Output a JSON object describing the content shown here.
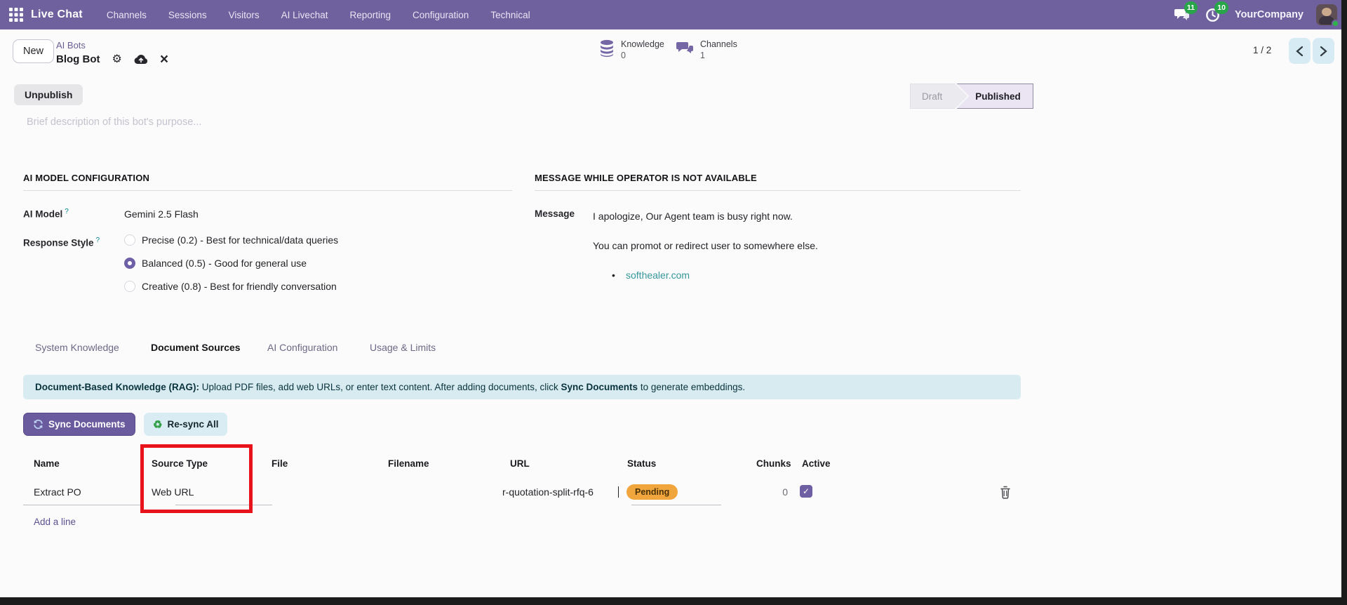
{
  "nav": {
    "app_name": "Live Chat",
    "menus": [
      "Channels",
      "Sessions",
      "Visitors",
      "AI Livechat",
      "Reporting",
      "Configuration",
      "Technical"
    ],
    "messages_badge": "11",
    "activities_badge": "10",
    "company": "YourCompany"
  },
  "control_panel": {
    "new_button": "New",
    "breadcrumb_parent": "AI Bots",
    "breadcrumb_current": "Blog Bot",
    "pager": "1 / 2",
    "stat_buttons": [
      {
        "label": "Knowledge",
        "value": "0",
        "icon": "database-icon"
      },
      {
        "label": "Channels",
        "value": "1",
        "icon": "chat-bubbles-icon"
      }
    ]
  },
  "form": {
    "unpublish_button": "Unpublish",
    "stages": {
      "draft": "Draft",
      "published": "Published",
      "active_stage": "Published"
    },
    "description_placeholder": "Brief description of this bot's purpose...",
    "ai_section": {
      "title": "AI MODEL CONFIGURATION",
      "ai_model_label": "AI Model",
      "help_marker": "?",
      "ai_model_value": "Gemini 2.5 Flash",
      "response_style_label": "Response Style",
      "options": [
        {
          "label": "Precise (0.2) - Best for technical/data queries",
          "selected": false
        },
        {
          "label": "Balanced (0.5) - Good for general use",
          "selected": true
        },
        {
          "label": "Creative (0.8) - Best for friendly conversation",
          "selected": false
        }
      ]
    },
    "message_section": {
      "title": "MESSAGE WHILE OPERATOR IS NOT AVAILABLE",
      "label": "Message",
      "line1": "I apologize, Our Agent team is busy right now.",
      "line2": "You can promot or redirect user to somewhere else.",
      "bullet": "•",
      "bullet_link": "softhealer.com"
    }
  },
  "tabs": [
    {
      "label": "System Knowledge",
      "active": false
    },
    {
      "label": "Document Sources",
      "active": true
    },
    {
      "label": "AI Configuration",
      "active": false
    },
    {
      "label": "Usage & Limits",
      "active": false
    }
  ],
  "rag_banner": {
    "bold_intro": "Document-Based Knowledge (RAG):",
    "text_1": " Upload PDF files, add web URLs, or enter text content. After adding documents, click ",
    "bold_mid": "Sync Documents",
    "text_2": " to generate embeddings."
  },
  "doc_actions": {
    "sync_button": "Sync Documents",
    "resync_button": "Re-sync All",
    "recycle_glyph": "♻"
  },
  "documents_table": {
    "headers": [
      "Name",
      "Source Type",
      "File",
      "Filename",
      "URL",
      "Status",
      "Chunks",
      "Active"
    ],
    "rows": [
      {
        "name": "Extract PO",
        "source_type": "Web URL",
        "file": "",
        "filename": "",
        "url": "r-quotation-split-rfq-6",
        "status": "Pending",
        "chunks": "0",
        "active": true
      }
    ],
    "add_line": "Add a line",
    "checkmark": "✓"
  },
  "icons": {
    "gear": "⚙",
    "close": "×"
  },
  "colors": {
    "nav_purple": "#6e619e",
    "badge_green": "#27a548",
    "accent_purple": "#6f5fa7",
    "link_teal": "#35979b",
    "banner_bg": "#d7ebf1",
    "pending_bg": "#f0a63c",
    "highlight_red": "#e8131a"
  }
}
